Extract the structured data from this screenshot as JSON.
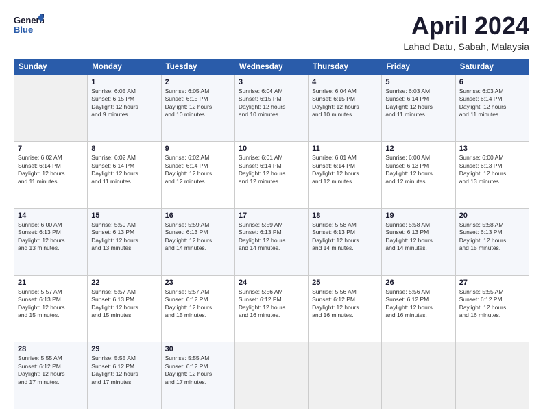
{
  "logo": {
    "line1": "General",
    "line2": "Blue"
  },
  "header": {
    "month": "April 2024",
    "location": "Lahad Datu, Sabah, Malaysia"
  },
  "columns": [
    "Sunday",
    "Monday",
    "Tuesday",
    "Wednesday",
    "Thursday",
    "Friday",
    "Saturday"
  ],
  "weeks": [
    [
      {
        "day": "",
        "info": ""
      },
      {
        "day": "1",
        "info": "Sunrise: 6:05 AM\nSunset: 6:15 PM\nDaylight: 12 hours\nand 9 minutes."
      },
      {
        "day": "2",
        "info": "Sunrise: 6:05 AM\nSunset: 6:15 PM\nDaylight: 12 hours\nand 10 minutes."
      },
      {
        "day": "3",
        "info": "Sunrise: 6:04 AM\nSunset: 6:15 PM\nDaylight: 12 hours\nand 10 minutes."
      },
      {
        "day": "4",
        "info": "Sunrise: 6:04 AM\nSunset: 6:15 PM\nDaylight: 12 hours\nand 10 minutes."
      },
      {
        "day": "5",
        "info": "Sunrise: 6:03 AM\nSunset: 6:14 PM\nDaylight: 12 hours\nand 11 minutes."
      },
      {
        "day": "6",
        "info": "Sunrise: 6:03 AM\nSunset: 6:14 PM\nDaylight: 12 hours\nand 11 minutes."
      }
    ],
    [
      {
        "day": "7",
        "info": "Sunrise: 6:02 AM\nSunset: 6:14 PM\nDaylight: 12 hours\nand 11 minutes."
      },
      {
        "day": "8",
        "info": "Sunrise: 6:02 AM\nSunset: 6:14 PM\nDaylight: 12 hours\nand 11 minutes."
      },
      {
        "day": "9",
        "info": "Sunrise: 6:02 AM\nSunset: 6:14 PM\nDaylight: 12 hours\nand 12 minutes."
      },
      {
        "day": "10",
        "info": "Sunrise: 6:01 AM\nSunset: 6:14 PM\nDaylight: 12 hours\nand 12 minutes."
      },
      {
        "day": "11",
        "info": "Sunrise: 6:01 AM\nSunset: 6:14 PM\nDaylight: 12 hours\nand 12 minutes."
      },
      {
        "day": "12",
        "info": "Sunrise: 6:00 AM\nSunset: 6:13 PM\nDaylight: 12 hours\nand 12 minutes."
      },
      {
        "day": "13",
        "info": "Sunrise: 6:00 AM\nSunset: 6:13 PM\nDaylight: 12 hours\nand 13 minutes."
      }
    ],
    [
      {
        "day": "14",
        "info": "Sunrise: 6:00 AM\nSunset: 6:13 PM\nDaylight: 12 hours\nand 13 minutes."
      },
      {
        "day": "15",
        "info": "Sunrise: 5:59 AM\nSunset: 6:13 PM\nDaylight: 12 hours\nand 13 minutes."
      },
      {
        "day": "16",
        "info": "Sunrise: 5:59 AM\nSunset: 6:13 PM\nDaylight: 12 hours\nand 14 minutes."
      },
      {
        "day": "17",
        "info": "Sunrise: 5:59 AM\nSunset: 6:13 PM\nDaylight: 12 hours\nand 14 minutes."
      },
      {
        "day": "18",
        "info": "Sunrise: 5:58 AM\nSunset: 6:13 PM\nDaylight: 12 hours\nand 14 minutes."
      },
      {
        "day": "19",
        "info": "Sunrise: 5:58 AM\nSunset: 6:13 PM\nDaylight: 12 hours\nand 14 minutes."
      },
      {
        "day": "20",
        "info": "Sunrise: 5:58 AM\nSunset: 6:13 PM\nDaylight: 12 hours\nand 15 minutes."
      }
    ],
    [
      {
        "day": "21",
        "info": "Sunrise: 5:57 AM\nSunset: 6:13 PM\nDaylight: 12 hours\nand 15 minutes."
      },
      {
        "day": "22",
        "info": "Sunrise: 5:57 AM\nSunset: 6:13 PM\nDaylight: 12 hours\nand 15 minutes."
      },
      {
        "day": "23",
        "info": "Sunrise: 5:57 AM\nSunset: 6:12 PM\nDaylight: 12 hours\nand 15 minutes."
      },
      {
        "day": "24",
        "info": "Sunrise: 5:56 AM\nSunset: 6:12 PM\nDaylight: 12 hours\nand 16 minutes."
      },
      {
        "day": "25",
        "info": "Sunrise: 5:56 AM\nSunset: 6:12 PM\nDaylight: 12 hours\nand 16 minutes."
      },
      {
        "day": "26",
        "info": "Sunrise: 5:56 AM\nSunset: 6:12 PM\nDaylight: 12 hours\nand 16 minutes."
      },
      {
        "day": "27",
        "info": "Sunrise: 5:55 AM\nSunset: 6:12 PM\nDaylight: 12 hours\nand 16 minutes."
      }
    ],
    [
      {
        "day": "28",
        "info": "Sunrise: 5:55 AM\nSunset: 6:12 PM\nDaylight: 12 hours\nand 17 minutes."
      },
      {
        "day": "29",
        "info": "Sunrise: 5:55 AM\nSunset: 6:12 PM\nDaylight: 12 hours\nand 17 minutes."
      },
      {
        "day": "30",
        "info": "Sunrise: 5:55 AM\nSunset: 6:12 PM\nDaylight: 12 hours\nand 17 minutes."
      },
      {
        "day": "",
        "info": ""
      },
      {
        "day": "",
        "info": ""
      },
      {
        "day": "",
        "info": ""
      },
      {
        "day": "",
        "info": ""
      }
    ]
  ]
}
